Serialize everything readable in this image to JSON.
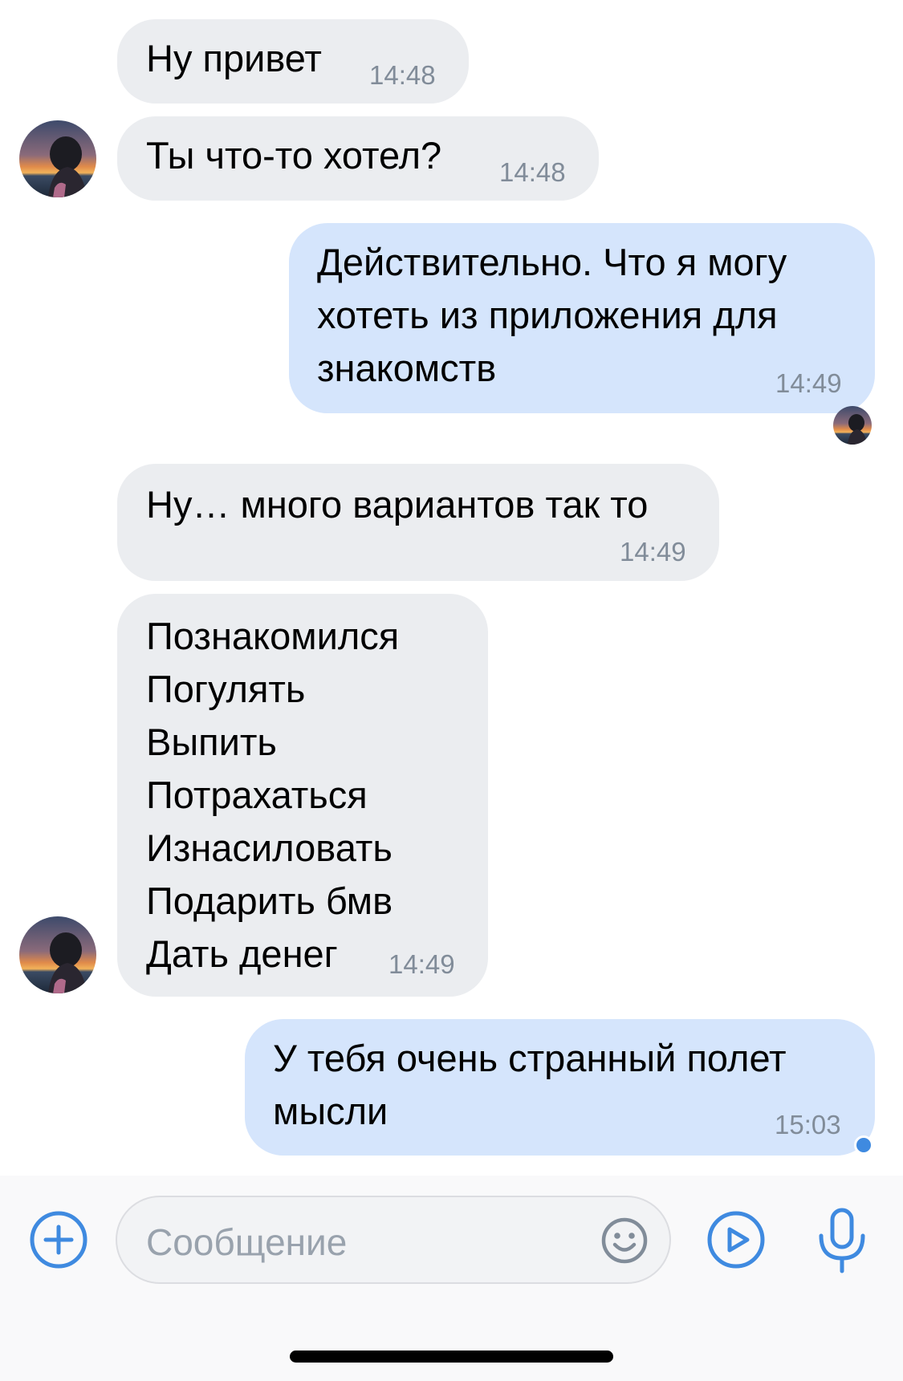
{
  "messages": [
    {
      "text": "Ну привет",
      "time": "14:48",
      "direction": "incoming"
    },
    {
      "text": "Ты что-то хотел?",
      "time": "14:48",
      "direction": "incoming"
    },
    {
      "lines": [
        "Действительно. Что я могу",
        "хотеть из приложения для",
        "знакомств"
      ],
      "time": "14:49",
      "direction": "outgoing"
    },
    {
      "text": "Ну… много вариантов так то",
      "time": "14:49",
      "direction": "incoming"
    },
    {
      "lines": [
        "Познакомился",
        "Погулять",
        "Выпить",
        "Потрахаться",
        "Изнасиловать",
        "Подарить бмв",
        "Дать денег"
      ],
      "time": "14:49",
      "direction": "incoming"
    },
    {
      "lines": [
        "У тебя очень странный полет",
        "мысли"
      ],
      "time": "15:03",
      "direction": "outgoing",
      "status": "unread"
    }
  ],
  "composer": {
    "placeholder": "Сообщение",
    "icons": {
      "attach": "plus-circle-icon",
      "emoji": "smile-icon",
      "video": "play-circle-icon",
      "voice": "microphone-icon"
    }
  },
  "colors": {
    "incoming_bubble": "#ebedf0",
    "outgoing_bubble": "#d5e5fc",
    "accent": "#3f8ae0",
    "time_text": "#818c99"
  }
}
